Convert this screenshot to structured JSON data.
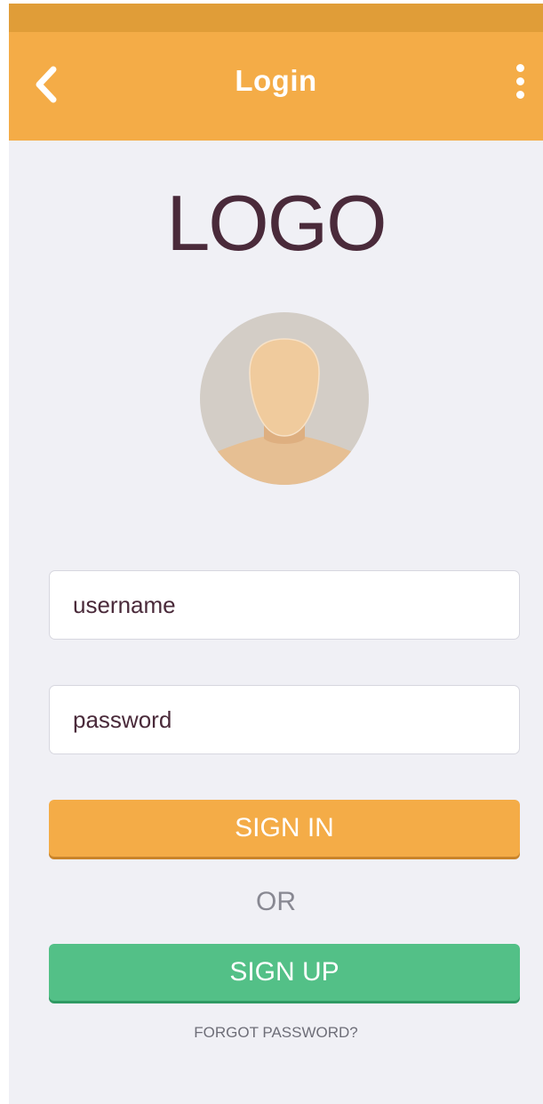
{
  "status_bar": {},
  "app_bar": {
    "title": "Login",
    "back_icon": "chevron-left-icon",
    "menu_icon": "more-vertical-icon",
    "background_color": "#f4ac47",
    "status_bar_color": "#e09d38"
  },
  "logo": {
    "text": "LOGO",
    "color": "#4a2a3a"
  },
  "avatar": {
    "icon": "user-avatar-icon"
  },
  "form": {
    "username_placeholder": "username",
    "password_placeholder": "password",
    "sign_in_label": "SIGN IN",
    "or_label": "OR",
    "sign_up_label": "SIGN UP",
    "forgot_password_label": "FORGOT PASSWORD?",
    "sign_in_color": "#f4ac47",
    "sign_up_color": "#53c087"
  }
}
